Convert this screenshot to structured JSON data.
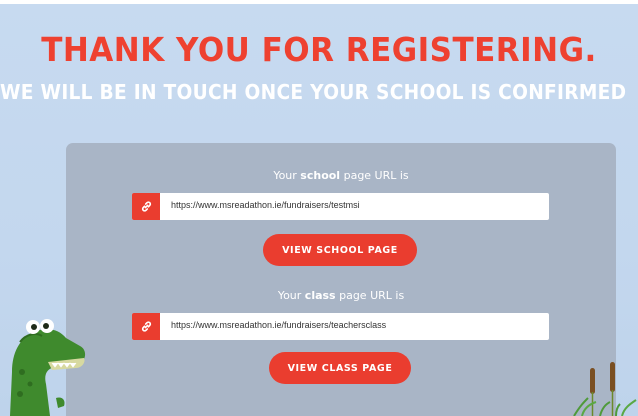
{
  "hero": {
    "title": "THANK YOU FOR REGISTERING.",
    "subtitle": "WE WILL BE IN TOUCH ONCE YOUR SCHOOL IS CONFIRMED"
  },
  "school": {
    "label_prefix": "Your ",
    "label_bold": "school",
    "label_suffix": " page URL is",
    "url": "https://www.msreadathon.ie/fundraisers/testmsi",
    "button": "VIEW SCHOOL PAGE"
  },
  "class_section": {
    "label_prefix": "Your ",
    "label_bold": "class",
    "label_suffix": " page URL is",
    "url": "https://www.msreadathon.ie/fundraisers/teachersclass",
    "button": "VIEW CLASS PAGE"
  },
  "icons": {
    "link": "link-icon",
    "mascot": "dinosaur-mascot",
    "decoration": "reeds-decoration"
  },
  "colors": {
    "accent": "#ea3d2f",
    "background": "#c5d9ef",
    "card": "#a9b5c6",
    "text_light": "#ffffff"
  }
}
